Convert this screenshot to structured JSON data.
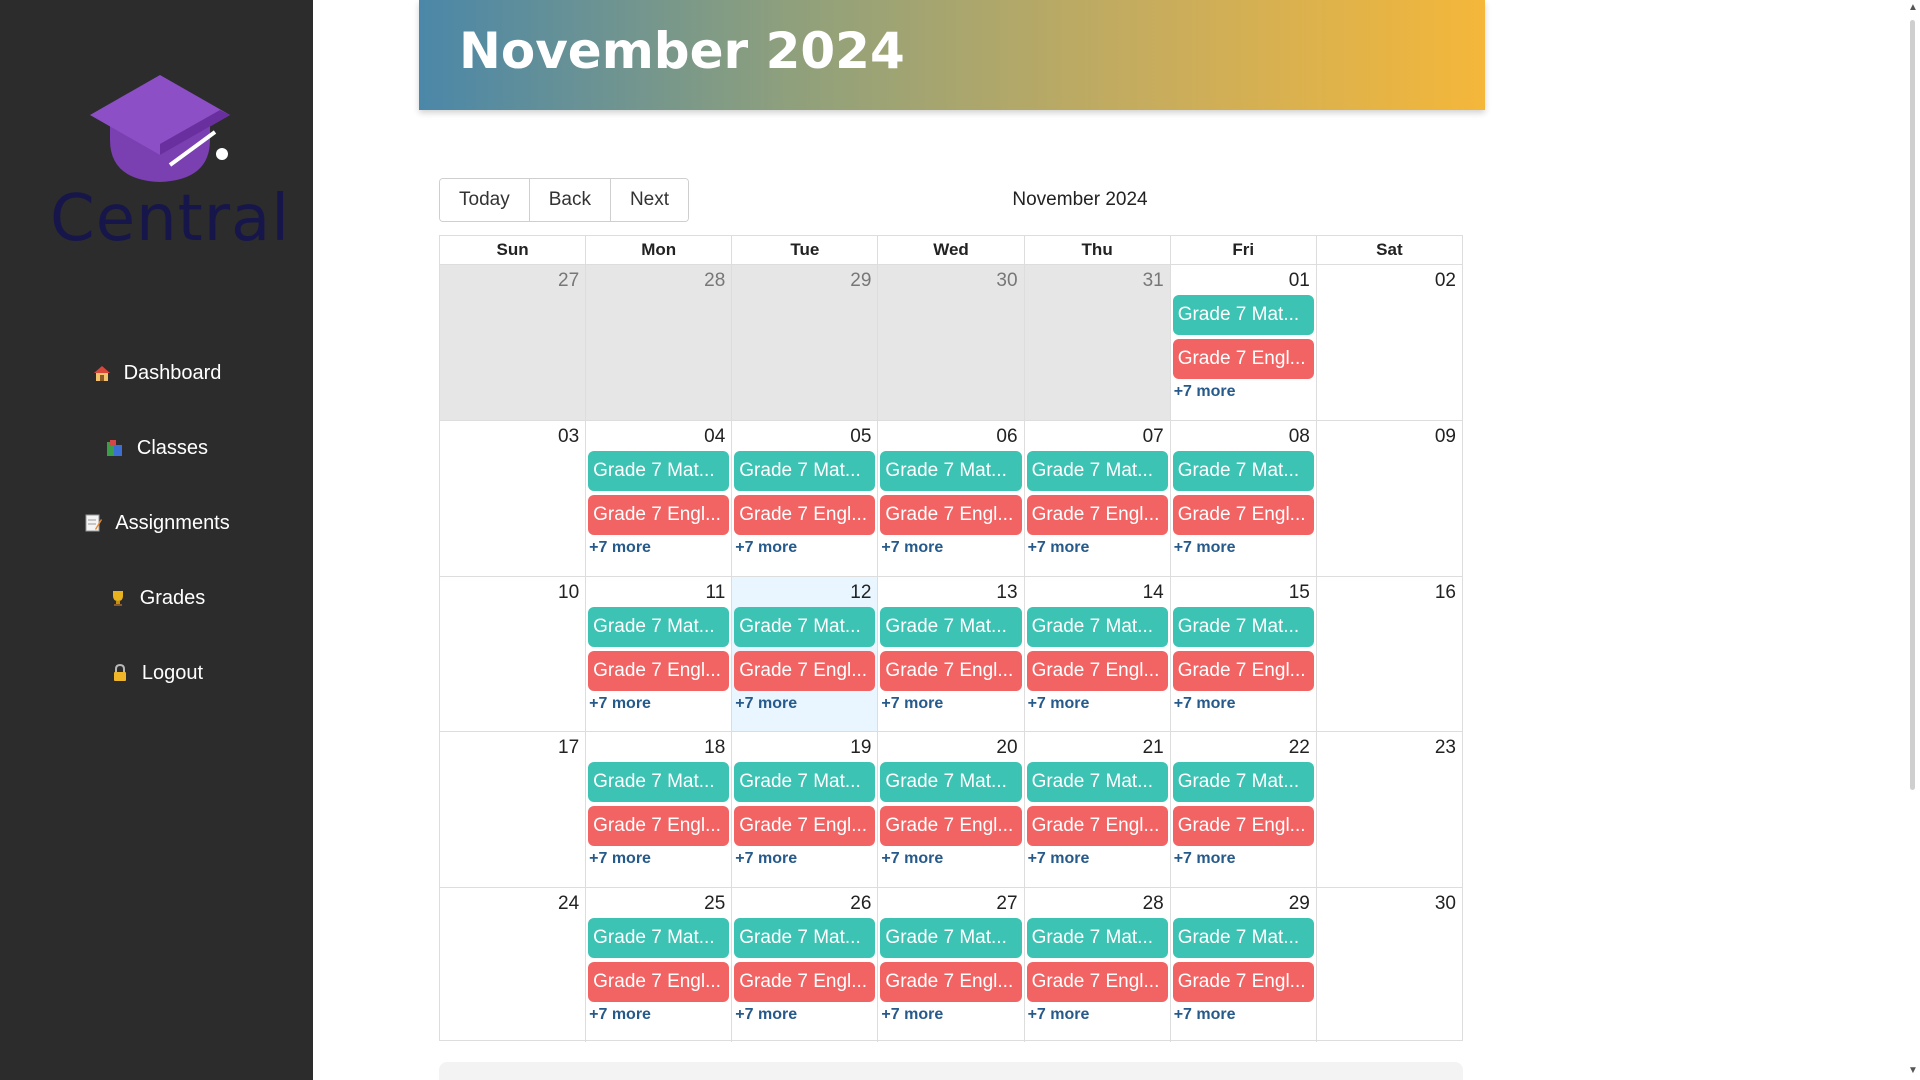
{
  "app": {
    "brand": "Central"
  },
  "colors": {
    "sidebar": "#2c2c2c",
    "math_event": "#3cc3b4",
    "english_event": "#f26464",
    "more_link": "#265a8a",
    "today_bg": "#eaf6ff",
    "off_month_bg": "#e6e6e6"
  },
  "sidebar": {
    "items": [
      {
        "label": "Dashboard",
        "icon": "house-icon"
      },
      {
        "label": "Classes",
        "icon": "books-icon"
      },
      {
        "label": "Assignments",
        "icon": "memo-icon"
      },
      {
        "label": "Grades",
        "icon": "trophy-icon"
      },
      {
        "label": "Logout",
        "icon": "lock-icon"
      }
    ]
  },
  "banner": {
    "title": "November 2024"
  },
  "toolbar": {
    "today": "Today",
    "back": "Back",
    "next": "Next",
    "label": "November 2024"
  },
  "calendar": {
    "days_of_week": [
      "Sun",
      "Mon",
      "Tue",
      "Wed",
      "Thu",
      "Fri",
      "Sat"
    ],
    "event_labels": {
      "math": "Grade 7 Mat...",
      "english": "Grade 7 Engl..."
    },
    "more_label": "+7 more",
    "weeks": [
      [
        {
          "num": "27",
          "off": true
        },
        {
          "num": "28",
          "off": true
        },
        {
          "num": "29",
          "off": true
        },
        {
          "num": "30",
          "off": true
        },
        {
          "num": "31",
          "off": true
        },
        {
          "num": "01",
          "events": true
        },
        {
          "num": "02"
        }
      ],
      [
        {
          "num": "03"
        },
        {
          "num": "04",
          "events": true
        },
        {
          "num": "05",
          "events": true
        },
        {
          "num": "06",
          "events": true
        },
        {
          "num": "07",
          "events": true
        },
        {
          "num": "08",
          "events": true
        },
        {
          "num": "09"
        }
      ],
      [
        {
          "num": "10"
        },
        {
          "num": "11",
          "events": true
        },
        {
          "num": "12",
          "events": true,
          "today": true
        },
        {
          "num": "13",
          "events": true
        },
        {
          "num": "14",
          "events": true
        },
        {
          "num": "15",
          "events": true
        },
        {
          "num": "16"
        }
      ],
      [
        {
          "num": "17"
        },
        {
          "num": "18",
          "events": true
        },
        {
          "num": "19",
          "events": true
        },
        {
          "num": "20",
          "events": true
        },
        {
          "num": "21",
          "events": true
        },
        {
          "num": "22",
          "events": true
        },
        {
          "num": "23"
        }
      ],
      [
        {
          "num": "24"
        },
        {
          "num": "25",
          "events": true
        },
        {
          "num": "26",
          "events": true
        },
        {
          "num": "27",
          "events": true
        },
        {
          "num": "28",
          "events": true
        },
        {
          "num": "29",
          "events": true
        },
        {
          "num": "30"
        }
      ]
    ]
  }
}
